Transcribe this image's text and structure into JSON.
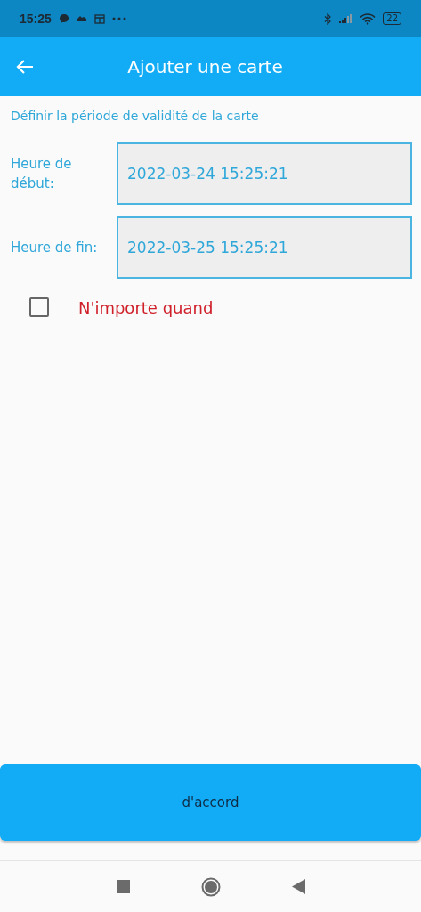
{
  "status_bar": {
    "time": "15:25",
    "battery": "22"
  },
  "app_bar": {
    "title": "Ajouter une carte"
  },
  "section_title": "Définir la période de validité de la carte",
  "fields": [
    {
      "label": "Heure de début:",
      "value": "2022-03-24 15:25:21"
    },
    {
      "label": "Heure de fin:",
      "value": "2022-03-25 15:25:21"
    }
  ],
  "anytime": {
    "label": "N'importe quand",
    "checked": false
  },
  "confirm_button": "d'accord"
}
